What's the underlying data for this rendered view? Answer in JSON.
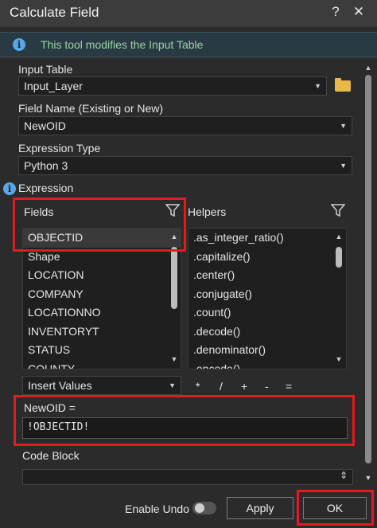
{
  "window": {
    "title": "Calculate Field",
    "help_glyph": "?",
    "close_glyph": "✕"
  },
  "info_bar": {
    "message": "This tool modifies the Input Table"
  },
  "input_table": {
    "label": "Input Table",
    "value": "Input_Layer"
  },
  "field_name": {
    "label": "Field Name (Existing or New)",
    "value": "NewOID"
  },
  "expression_type": {
    "label": "Expression Type",
    "value": "Python 3"
  },
  "expression": {
    "label": "Expression",
    "fields_label": "Fields",
    "helpers_label": "Helpers",
    "fields": [
      "OBJECTID",
      "Shape",
      "LOCATION",
      "COMPANY",
      "LOCATIONNO",
      "INVENTORYT",
      "STATUS",
      "COUNTY"
    ],
    "helpers": [
      ".as_integer_ratio()",
      ".capitalize()",
      ".center()",
      ".conjugate()",
      ".count()",
      ".decode()",
      ".denominator()",
      ".encode()"
    ],
    "insert_values": "Insert Values",
    "operators": [
      "*",
      "/",
      "+",
      "-",
      "="
    ],
    "assign_label": "NewOID =",
    "expression_value": "!OBJECTID!"
  },
  "code_block": {
    "label": "Code Block"
  },
  "footer": {
    "enable_undo": "Enable Undo",
    "apply": "Apply",
    "ok": "OK"
  },
  "colors": {
    "highlight": "#e21b23",
    "info_text": "#9bd2a4",
    "folder": "#e8b84a"
  }
}
